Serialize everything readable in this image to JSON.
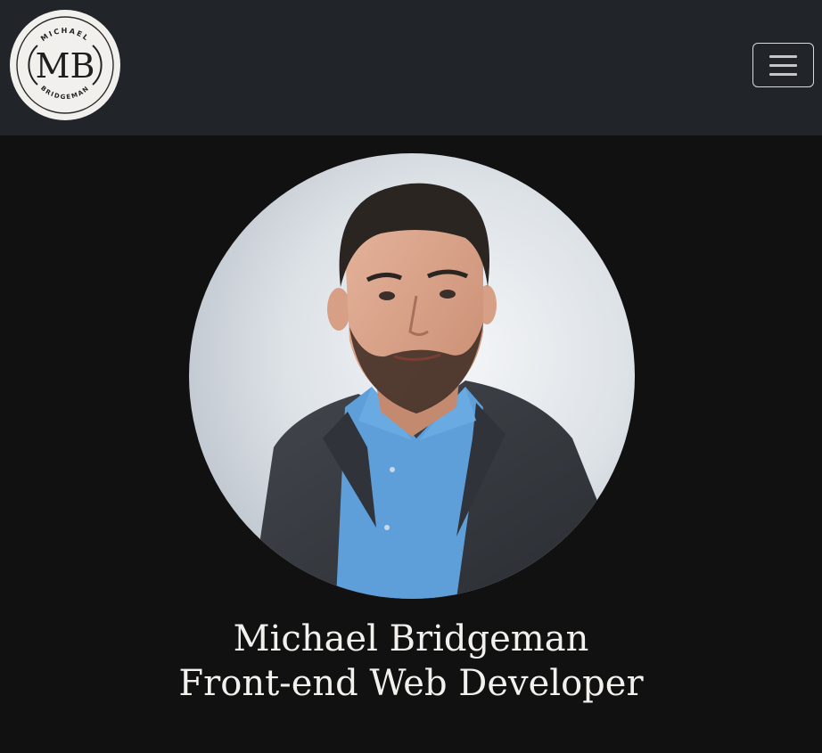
{
  "header": {
    "logo": {
      "initials": "MB",
      "top_text": "MICHAEL",
      "bottom_text": "BRIDGEMAN"
    },
    "menu_icon": "hamburger-menu-icon"
  },
  "hero": {
    "name": "Michael Bridgeman",
    "title": "Front-end Web Developer"
  },
  "colors": {
    "navbar_bg": "#212429",
    "page_bg": "#111112",
    "text": "#f3f1ee",
    "logo_bg": "#f2f0ec",
    "shirt": "#5f9fd9",
    "jacket": "#35393f"
  }
}
